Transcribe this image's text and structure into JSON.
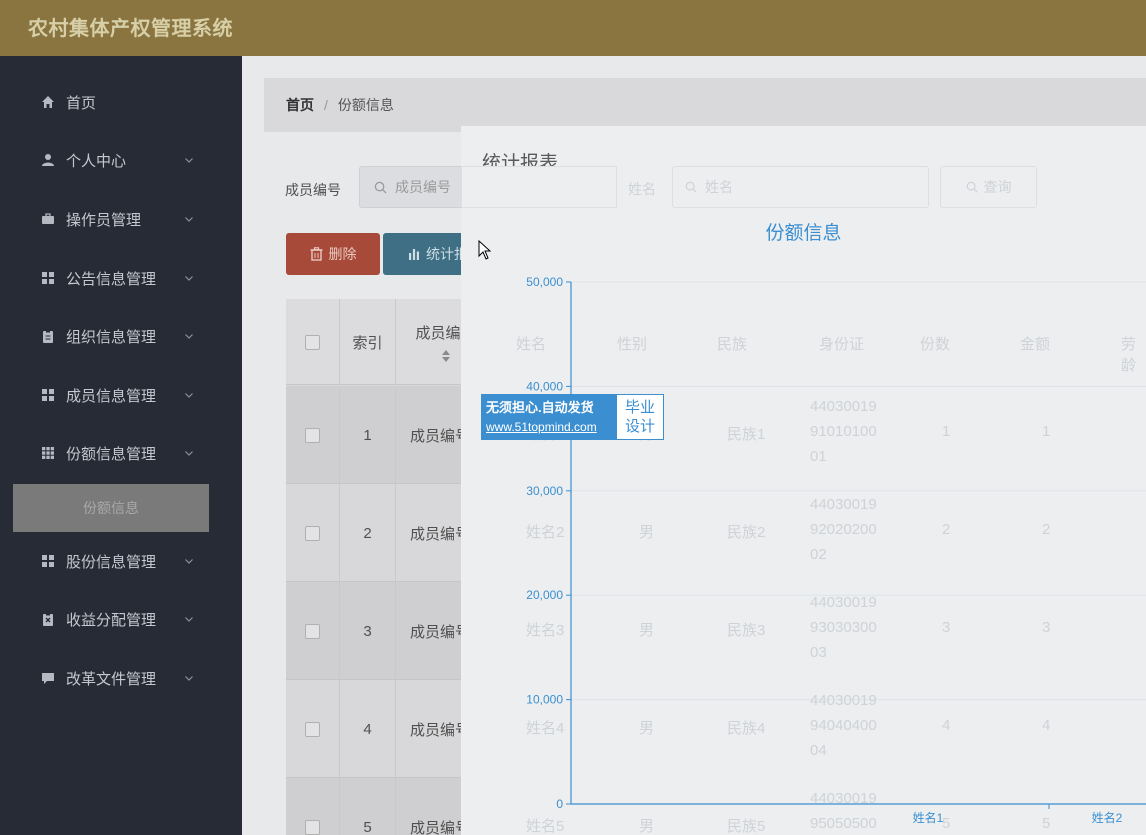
{
  "app": {
    "title": "农村集体产权管理系统"
  },
  "sidebar": {
    "items": [
      {
        "label": "首页",
        "icon": "home-icon",
        "expandable": false
      },
      {
        "label": "个人中心",
        "icon": "user-icon",
        "expandable": true
      },
      {
        "label": "操作员管理",
        "icon": "briefcase-icon",
        "expandable": true
      },
      {
        "label": "公告信息管理",
        "icon": "grid-icon",
        "expandable": true
      },
      {
        "label": "组织信息管理",
        "icon": "clipboard-icon",
        "expandable": true
      },
      {
        "label": "成员信息管理",
        "icon": "grid-icon",
        "expandable": true
      },
      {
        "label": "份额信息管理",
        "icon": "table-grid-icon",
        "expandable": true
      },
      {
        "label": "股份信息管理",
        "icon": "grid-icon",
        "expandable": true
      },
      {
        "label": "收益分配管理",
        "icon": "clipboard-x-icon",
        "expandable": true
      },
      {
        "label": "改革文件管理",
        "icon": "chat-icon",
        "expandable": true
      }
    ],
    "active_sub": "份额信息"
  },
  "breadcrumb": {
    "home": "首页",
    "separator": "/",
    "current": "份额信息"
  },
  "search": {
    "member_label": "成员编号",
    "member_placeholder": "成员编号",
    "name_label": "姓名",
    "name_placeholder": "姓名",
    "query_button": "查询"
  },
  "toolbar": {
    "delete_label": "删除",
    "stats_label": "统计报表"
  },
  "table": {
    "headers": [
      "索引",
      "成员编号",
      "姓名",
      "性别",
      "民族",
      "身份证",
      "份数",
      "金额",
      "劳龄"
    ],
    "rows": [
      {
        "index": "1",
        "member": "成员编号1",
        "name": "姓名1",
        "gender": "男",
        "ethnic": "民族1",
        "id": [
          "44030019",
          "91010100",
          "01"
        ],
        "shares": "1",
        "amount": "1"
      },
      {
        "index": "2",
        "member": "成员编号2",
        "name": "姓名2",
        "gender": "男",
        "ethnic": "民族2",
        "id": [
          "44030019",
          "92020200",
          "02"
        ],
        "shares": "2",
        "amount": "2"
      },
      {
        "index": "3",
        "member": "成员编号3",
        "name": "姓名3",
        "gender": "男",
        "ethnic": "民族3",
        "id": [
          "44030019",
          "93030300",
          "03"
        ],
        "shares": "3",
        "amount": "3"
      },
      {
        "index": "4",
        "member": "成员编号4",
        "name": "姓名4",
        "gender": "男",
        "ethnic": "民族4",
        "id": [
          "44030019",
          "94040400",
          "04"
        ],
        "shares": "4",
        "amount": "4"
      },
      {
        "index": "5",
        "member": "成员编号5",
        "name": "姓名5",
        "gender": "男",
        "ethnic": "民族5",
        "id": [
          "44030019",
          "95050500"
        ],
        "shares": "5",
        "amount": "5"
      }
    ]
  },
  "modal": {
    "title": "统计报表"
  },
  "chart_data": {
    "type": "bar",
    "title": "份额信息",
    "categories": [
      "姓名1",
      "姓名2"
    ],
    "y_ticks": [
      "0",
      "10,000",
      "20,000",
      "30,000",
      "40,000",
      "50,000"
    ],
    "ylim": [
      0,
      50000
    ],
    "axis_color": "#3b8fd0"
  },
  "watermark": {
    "line1": "无须担心.自动发货",
    "line2": "www.51topmind.com",
    "right1": "毕业",
    "right2": "设计"
  }
}
